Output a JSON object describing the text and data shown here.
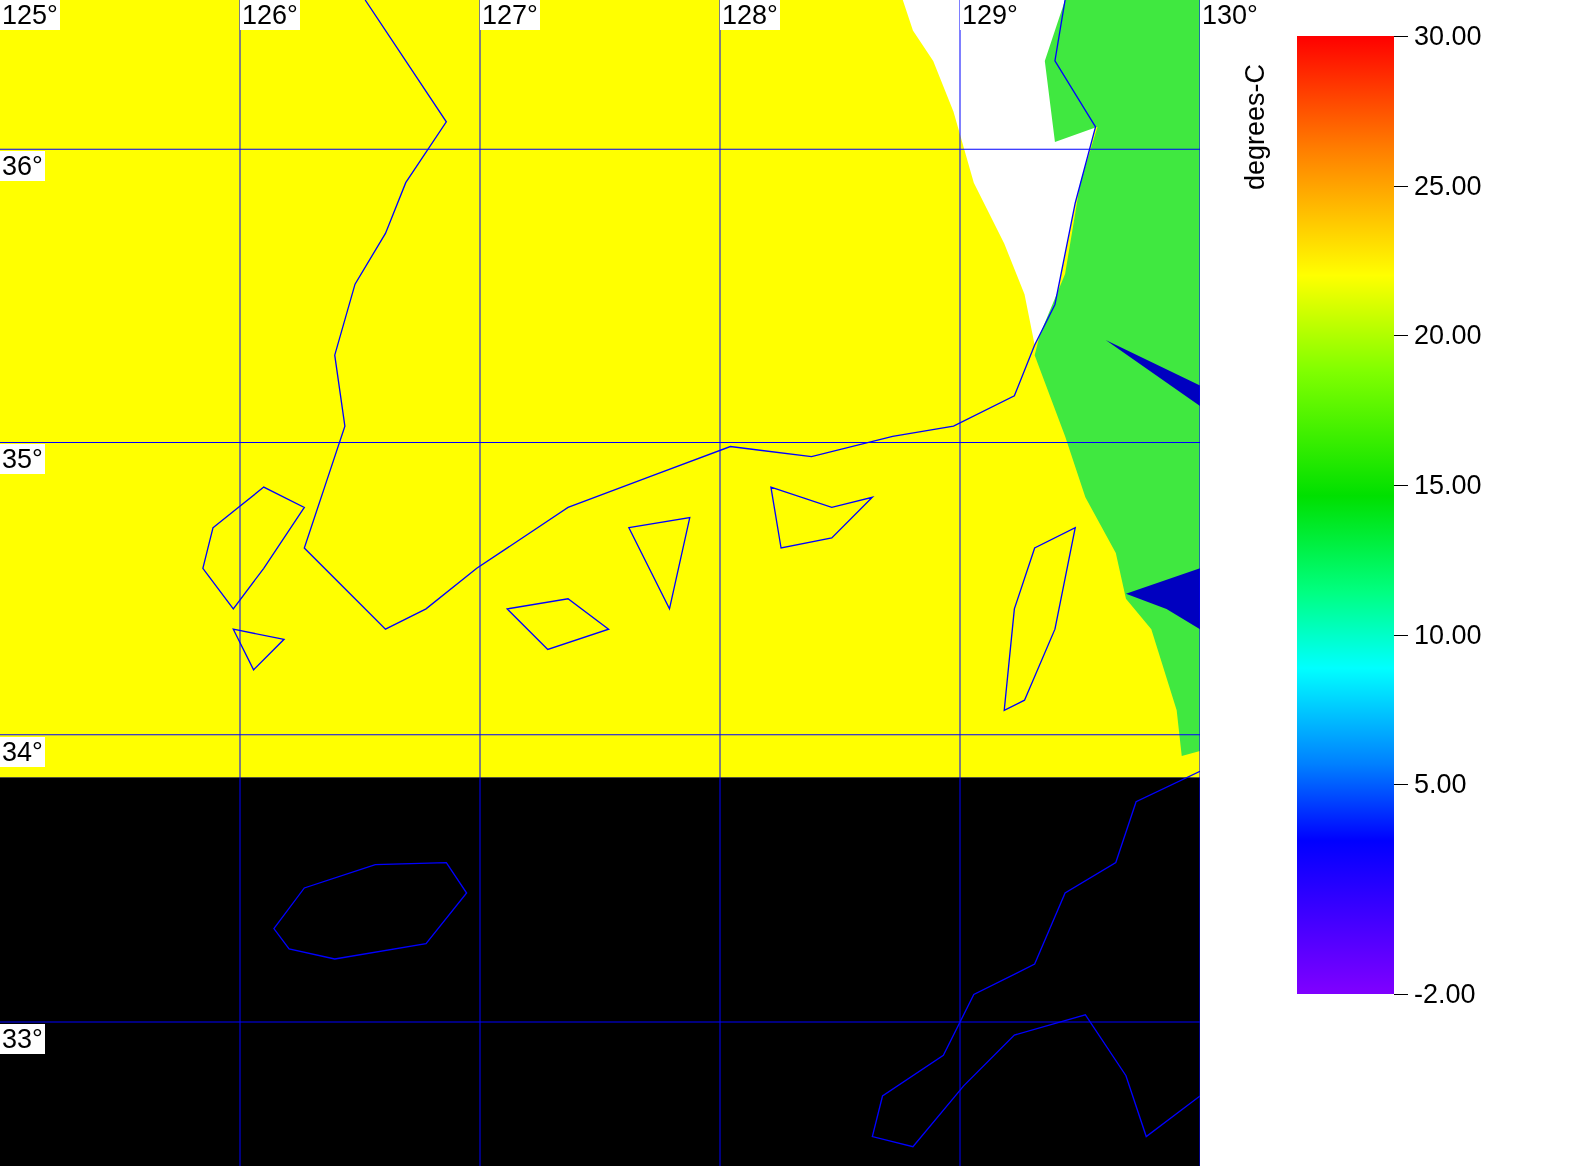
{
  "map": {
    "lon_labels": [
      "125°",
      "126°",
      "127°",
      "128°",
      "129°",
      "130°"
    ],
    "lat_labels": [
      "36°",
      "35°",
      "34°",
      "33°"
    ]
  },
  "colorbar": {
    "label": "degrees-C",
    "ticks": [
      "30.00",
      "25.00",
      "20.00",
      "15.00",
      "10.00",
      "5.00",
      "-2.00"
    ]
  }
}
